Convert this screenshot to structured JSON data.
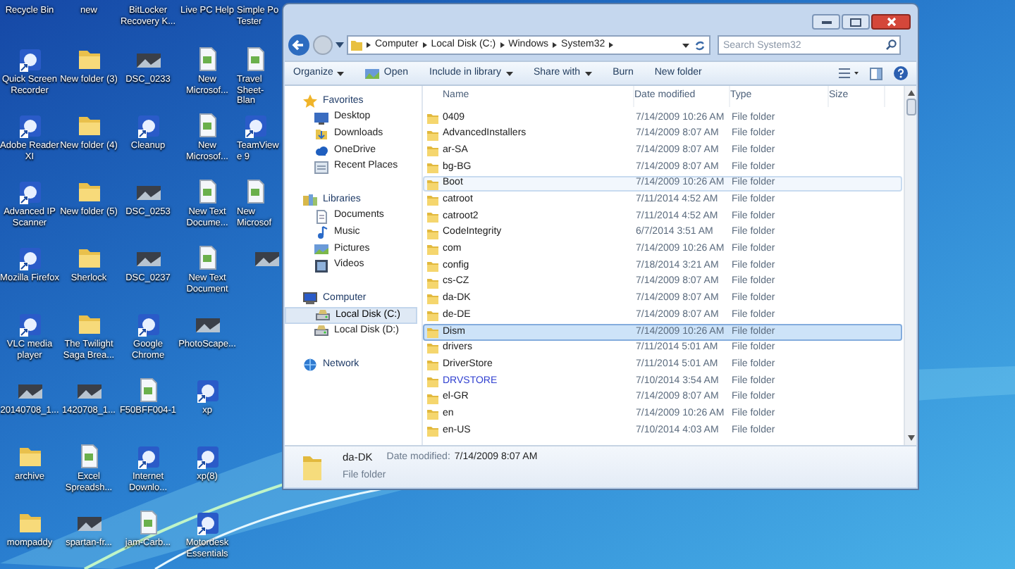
{
  "desktop": {
    "icons": [
      {
        "label": "Recycle Bin",
        "kind": "none"
      },
      {
        "label": "new",
        "kind": "none"
      },
      {
        "label": "BitLocker Recovery K...",
        "kind": "none"
      },
      {
        "label": "Live PC Help",
        "kind": "none"
      },
      {
        "label": "Simple Po Tester",
        "kind": "none",
        "cut": true
      },
      {
        "label": "Quick Screen Recorder",
        "kind": "program"
      },
      {
        "label": "New folder (3)",
        "kind": "folder"
      },
      {
        "label": "DSC_0233",
        "kind": "image"
      },
      {
        "label": "New Microsof...",
        "kind": "document"
      },
      {
        "label": "Travel Sheet-Blan",
        "kind": "document",
        "cut": true
      },
      {
        "label": "Adobe Reader XI",
        "kind": "program"
      },
      {
        "label": "New folder (4)",
        "kind": "folder"
      },
      {
        "label": "Cleanup",
        "kind": "program"
      },
      {
        "label": "New Microsof...",
        "kind": "document"
      },
      {
        "label": "TeamViewe 9",
        "kind": "program",
        "cut": true
      },
      {
        "label": "Advanced IP Scanner",
        "kind": "program"
      },
      {
        "label": "New folder (5)",
        "kind": "folder"
      },
      {
        "label": "DSC_0253",
        "kind": "image"
      },
      {
        "label": "New Text Docume...",
        "kind": "document"
      },
      {
        "label": "New Microsof",
        "kind": "document",
        "cut": true
      },
      {
        "label": "Mozilla Firefox",
        "kind": "program"
      },
      {
        "label": "Sherlock",
        "kind": "folder"
      },
      {
        "label": "DSC_0237",
        "kind": "image"
      },
      {
        "label": "New Text Document",
        "kind": "document"
      },
      {
        "kind": "image"
      },
      {
        "label": "VLC media player",
        "kind": "program"
      },
      {
        "label": "The Twilight Saga Brea...",
        "kind": "folder"
      },
      {
        "label": "Google Chrome",
        "kind": "program"
      },
      {
        "label": "PhotoScape...",
        "kind": "image"
      },
      {
        "kind": "none"
      },
      {
        "label": "20140708_1...",
        "kind": "image"
      },
      {
        "label": "1420708_1...",
        "kind": "image"
      },
      {
        "label": "F50BFF004-1",
        "kind": "document"
      },
      {
        "label": "xp",
        "kind": "program"
      },
      {
        "kind": "none"
      },
      {
        "label": "archive",
        "kind": "folder"
      },
      {
        "label": "Excel Spreadsh...",
        "kind": "document"
      },
      {
        "label": "Internet Downlo...",
        "kind": "program"
      },
      {
        "label": "xp(8)",
        "kind": "program"
      },
      {
        "kind": "none"
      },
      {
        "label": "mompaddy",
        "kind": "folder"
      },
      {
        "label": "spartan-fr...",
        "kind": "image"
      },
      {
        "label": "jam-Carb...",
        "kind": "document"
      },
      {
        "label": "Motordesk Essentials",
        "kind": "program"
      },
      {
        "kind": "none"
      }
    ]
  },
  "explorer": {
    "address_bar": {
      "path": [
        "Computer",
        "Local Disk (C:)",
        "Windows",
        "System32"
      ]
    },
    "search": {
      "placeholder": "Search System32"
    },
    "toolbar": [
      {
        "label": "Organize",
        "kind": "menu"
      },
      {
        "label": "Open",
        "kind": "open"
      },
      {
        "label": "Include in library",
        "kind": "menu"
      },
      {
        "label": "Share with",
        "kind": "menu"
      },
      {
        "label": "Burn",
        "kind": "plain"
      },
      {
        "label": "New folder",
        "kind": "plain"
      }
    ],
    "nav": [
      {
        "label": "Favorites",
        "kind": "star",
        "selected": false,
        "children": [
          {
            "label": "Desktop",
            "kind": "desktop",
            "selected": false
          },
          {
            "label": "Downloads",
            "kind": "download",
            "selected": false
          },
          {
            "label": "OneDrive",
            "kind": "cloud",
            "selected": false
          },
          {
            "label": "Recent Places",
            "kind": "places",
            "selected": false
          }
        ]
      },
      {
        "label": "Libraries",
        "kind": "library",
        "selected": false,
        "children": [
          {
            "label": "Documents",
            "kind": "document",
            "selected": false
          },
          {
            "label": "Music",
            "kind": "music",
            "selected": false
          },
          {
            "label": "Pictures",
            "kind": "picture",
            "selected": false
          },
          {
            "label": "Videos",
            "kind": "video",
            "selected": false
          }
        ]
      },
      {
        "label": "Computer",
        "kind": "computer",
        "selected": false,
        "children": [
          {
            "label": "Local Disk (C:)",
            "kind": "drive",
            "selected": true
          },
          {
            "label": "Local Disk (D:)",
            "kind": "drive",
            "selected": false
          }
        ]
      },
      {
        "label": "Network",
        "kind": "network",
        "selected": false
      }
    ],
    "file_list": {
      "columns": [
        "Name",
        "Date modified",
        "Type",
        "Size"
      ],
      "rows": [
        {
          "name": "0409",
          "date_modified": "7/14/2009 10:26 AM",
          "type": "File folder",
          "selected": false,
          "hovered": false,
          "color": "#1a1a1a"
        },
        {
          "name": "AdvancedInstallers",
          "date_modified": "7/14/2009 8:07 AM",
          "type": "File folder",
          "selected": false,
          "hovered": false,
          "color": "#1a1a1a"
        },
        {
          "name": "ar-SA",
          "date_modified": "7/14/2009 8:07 AM",
          "type": "File folder",
          "selected": false,
          "hovered": false,
          "color": "#1a1a1a"
        },
        {
          "name": "bg-BG",
          "date_modified": "7/14/2009 8:07 AM",
          "type": "File folder",
          "selected": false,
          "hovered": false,
          "color": "#1a1a1a"
        },
        {
          "name": "Boot",
          "date_modified": "7/14/2009 10:26 AM",
          "type": "File folder",
          "selected": false,
          "hovered": true,
          "color": "#1a1a1a"
        },
        {
          "name": "catroot",
          "date_modified": "7/11/2014 4:52 AM",
          "type": "File folder",
          "selected": false,
          "hovered": false,
          "color": "#1a1a1a"
        },
        {
          "name": "catroot2",
          "date_modified": "7/11/2014 4:52 AM",
          "type": "File folder",
          "selected": false,
          "hovered": false,
          "color": "#1a1a1a"
        },
        {
          "name": "CodeIntegrity",
          "date_modified": "6/7/2014 3:51 AM",
          "type": "File folder",
          "selected": false,
          "hovered": false,
          "color": "#1a1a1a"
        },
        {
          "name": "com",
          "date_modified": "7/14/2009 10:26 AM",
          "type": "File folder",
          "selected": false,
          "hovered": false,
          "color": "#1a1a1a"
        },
        {
          "name": "config",
          "date_modified": "7/18/2014 3:21 AM",
          "type": "File folder",
          "selected": false,
          "hovered": false,
          "color": "#1a1a1a"
        },
        {
          "name": "cs-CZ",
          "date_modified": "7/14/2009 8:07 AM",
          "type": "File folder",
          "selected": false,
          "hovered": false,
          "color": "#1a1a1a"
        },
        {
          "name": "da-DK",
          "date_modified": "7/14/2009 8:07 AM",
          "type": "File folder",
          "selected": false,
          "hovered": false,
          "color": "#1a1a1a"
        },
        {
          "name": "de-DE",
          "date_modified": "7/14/2009 8:07 AM",
          "type": "File folder",
          "selected": false,
          "hovered": false,
          "color": "#1a1a1a"
        },
        {
          "name": "Dism",
          "date_modified": "7/14/2009 10:26 AM",
          "type": "File folder",
          "selected": true,
          "hovered": false,
          "color": "#1a1a1a"
        },
        {
          "name": "drivers",
          "date_modified": "7/11/2014 5:01 AM",
          "type": "File folder",
          "selected": false,
          "hovered": false,
          "color": "#1a1a1a"
        },
        {
          "name": "DriverStore",
          "date_modified": "7/11/2014 5:01 AM",
          "type": "File folder",
          "selected": false,
          "hovered": false,
          "color": "#1a1a1a"
        },
        {
          "name": "DRVSTORE",
          "date_modified": "7/10/2014 3:54 AM",
          "type": "File folder",
          "selected": false,
          "hovered": false,
          "color": "#2f3fd0"
        },
        {
          "name": "el-GR",
          "date_modified": "7/14/2009 8:07 AM",
          "type": "File folder",
          "selected": false,
          "hovered": false,
          "color": "#1a1a1a"
        },
        {
          "name": "en",
          "date_modified": "7/14/2009 10:26 AM",
          "type": "File folder",
          "selected": false,
          "hovered": false,
          "color": "#1a1a1a"
        },
        {
          "name": "en-US",
          "date_modified": "7/10/2014 4:03 AM",
          "type": "File folder",
          "selected": false,
          "hovered": false,
          "color": "#1a1a1a"
        }
      ]
    },
    "details": {
      "name": "da-DK",
      "date_label": "Date modified:",
      "date": "7/14/2009 8:07 AM",
      "type": "File folder"
    }
  }
}
